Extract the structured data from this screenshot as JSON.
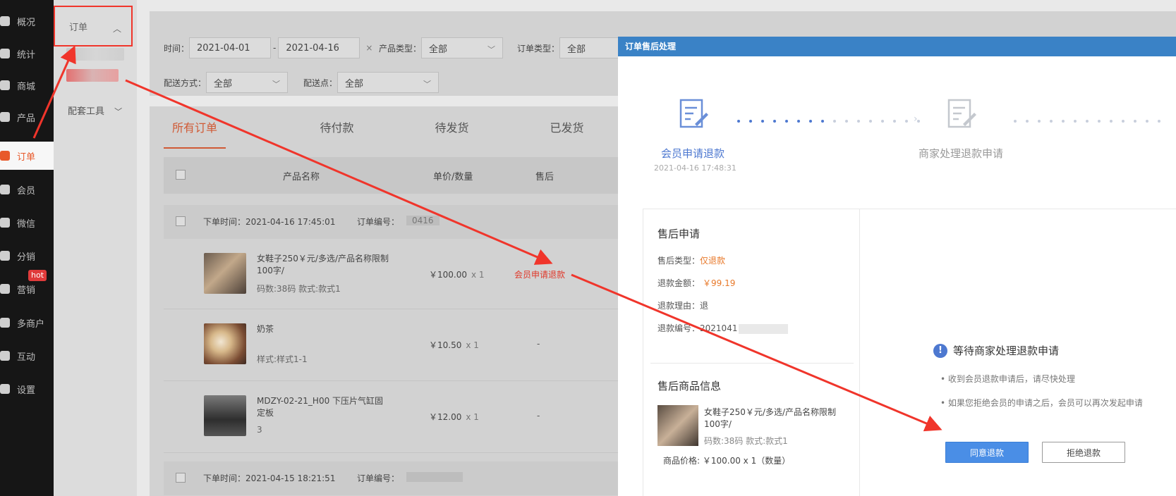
{
  "nav": {
    "items": [
      {
        "label": "概况",
        "icon": "layers-icon"
      },
      {
        "label": "统计",
        "icon": "chart-icon"
      },
      {
        "label": "商城",
        "icon": "mail-icon"
      },
      {
        "label": "产品",
        "icon": "grid-icon"
      },
      {
        "label": "订单",
        "icon": "order-icon",
        "active": true
      },
      {
        "label": "会员",
        "icon": "crown-icon"
      },
      {
        "label": "微信",
        "icon": "wechat-icon"
      },
      {
        "label": "分销",
        "icon": "share-icon"
      },
      {
        "label": "营销",
        "icon": "flag-icon"
      },
      {
        "label": "多商户",
        "icon": "store-icon"
      },
      {
        "label": "互动",
        "icon": "chat-icon"
      },
      {
        "label": "设置",
        "icon": "gear-icon"
      }
    ],
    "hot_badge": "hot"
  },
  "submenu": {
    "head_label": "订单",
    "tool_label": "配套工具"
  },
  "filters": {
    "time_label": "时间：",
    "date_from": "2021-04-01",
    "date_sep": "-",
    "date_to": "2021-04-16",
    "clear": "×",
    "product_type_label": "产品类型：",
    "product_type_value": "全部",
    "order_type_label": "订单类型：",
    "order_type_value": "全部",
    "delivery_label": "配送方式：",
    "delivery_value": "全部",
    "point_label": "配送点：",
    "point_value": "全部"
  },
  "tabs": [
    "所有订单",
    "待付款",
    "待发货",
    "已发货"
  ],
  "table": {
    "col_name": "产品名称",
    "col_price": "单价/数量",
    "col_after": "售后"
  },
  "orders": [
    {
      "time": "下单时间：2021-04-16 17:45:01",
      "no_label": "订单编号：",
      "no_partial": "0416"
    },
    {
      "time": "下单时间：2021-04-15 18:21:51",
      "no_label": "订单编号："
    }
  ],
  "products": [
    {
      "name": "女鞋子250￥元/多选/产品名称限制100字/",
      "attr": "码数:38码 款式:款式1",
      "price": "￥100.00",
      "qty": "x 1",
      "after": "会员申请退款"
    },
    {
      "name": "奶茶",
      "attr": "样式:样式1-1",
      "price": "￥10.50",
      "qty": "x 1",
      "after": "-"
    },
    {
      "name": "MDZY-02-21_H00 下压片气缸固定板",
      "attr": "3",
      "price": "￥12.00",
      "qty": "x 1",
      "after": "-"
    }
  ],
  "modal": {
    "title": "订单售后处理",
    "step1_label": "会员申请退款",
    "step1_time": "2021-04-16 17:48:31",
    "step2_label": "商家处理退款申请",
    "apply_title": "售后申请",
    "type_label": "售后类型：",
    "type_value": "仅退款",
    "amount_label": "退款金额：",
    "amount_value": "￥99.19",
    "reason_label": "退款理由：",
    "reason_value": "退",
    "refund_no_label": "退款编号：",
    "refund_no_value": "2021041",
    "goods_title": "售后商品信息",
    "goods_name": "女鞋子250￥元/多选/产品名称限制100字/",
    "goods_attr": "码数:38码 款式:款式1",
    "goods_price": "商品价格: ￥100.00 x 1（数量）",
    "wait_title": "等待商家处理退款申请",
    "tip1": "收到会员退款申请后，请尽快处理",
    "tip2": "如果您拒绝会员的申请之后，会员可以再次发起申请",
    "agree_btn": "同意退款",
    "reject_btn": "拒绝退款"
  },
  "colors": {
    "accent_blue": "#3a82c6",
    "brand_orange": "#e8592a",
    "annotation_red": "#f0352b"
  }
}
